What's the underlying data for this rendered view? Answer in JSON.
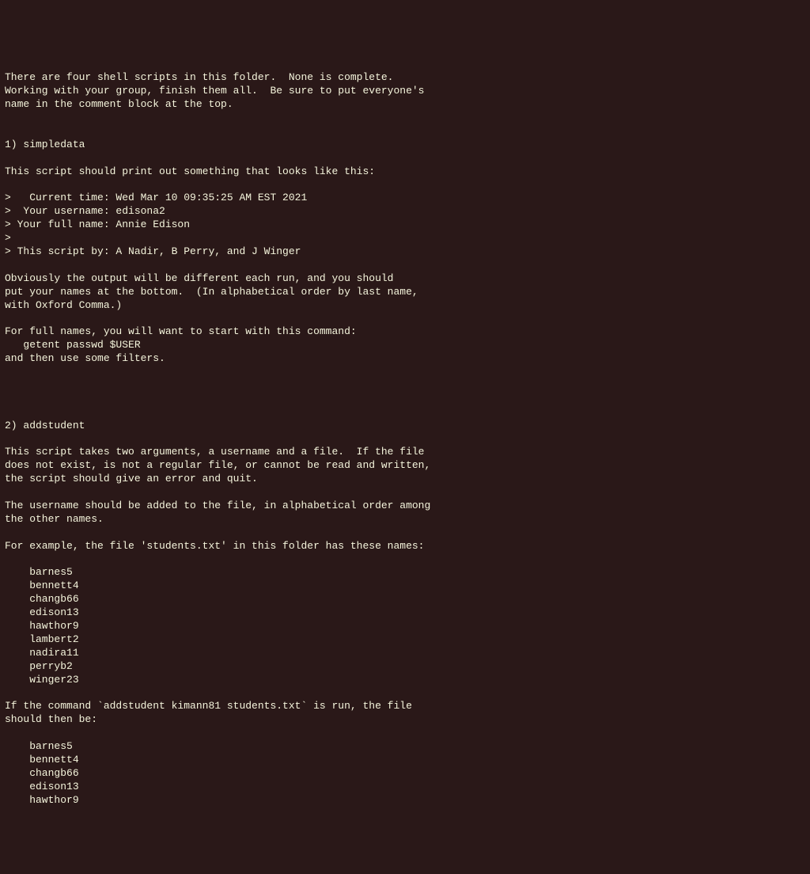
{
  "document": {
    "intro": "There are four shell scripts in this folder.  None is complete.\nWorking with your group, finish them all.  Be sure to put everyone's\nname in the comment block at the top.",
    "section1": {
      "header": "1) simpledata",
      "description": "This script should print out something that looks like this:",
      "example_output": ">   Current time: Wed Mar 10 09:35:25 AM EST 2021\n>  Your username: edisona2\n> Your full name: Annie Edison\n>\n> This script by: A Nadir, B Perry, and J Winger",
      "explanation1": "Obviously the output will be different each run, and you should\nput your names at the bottom.  (In alphabetical order by last name,\nwith Oxford Comma.)",
      "explanation2": "For full names, you will want to start with this command:\n   getent passwd $USER\nand then use some filters."
    },
    "section2": {
      "header": "2) addstudent",
      "description": "This script takes two arguments, a username and a file.  If the file\ndoes not exist, is not a regular file, or cannot be read and written,\nthe script should give an error and quit.",
      "explanation1": "The username should be added to the file, in alphabetical order among\nthe other names.",
      "example_intro": "For example, the file 'students.txt' in this folder has these names:",
      "example_list1": "    barnes5\n    bennett4\n    changb66\n    edison13\n    hawthor9\n    lambert2\n    nadira11\n    perryb2\n    winger23",
      "example_command": "If the command `addstudent kimann81 students.txt` is run, the file\nshould then be:",
      "example_list2": "    barnes5\n    bennett4\n    changb66\n    edison13\n    hawthor9"
    }
  }
}
